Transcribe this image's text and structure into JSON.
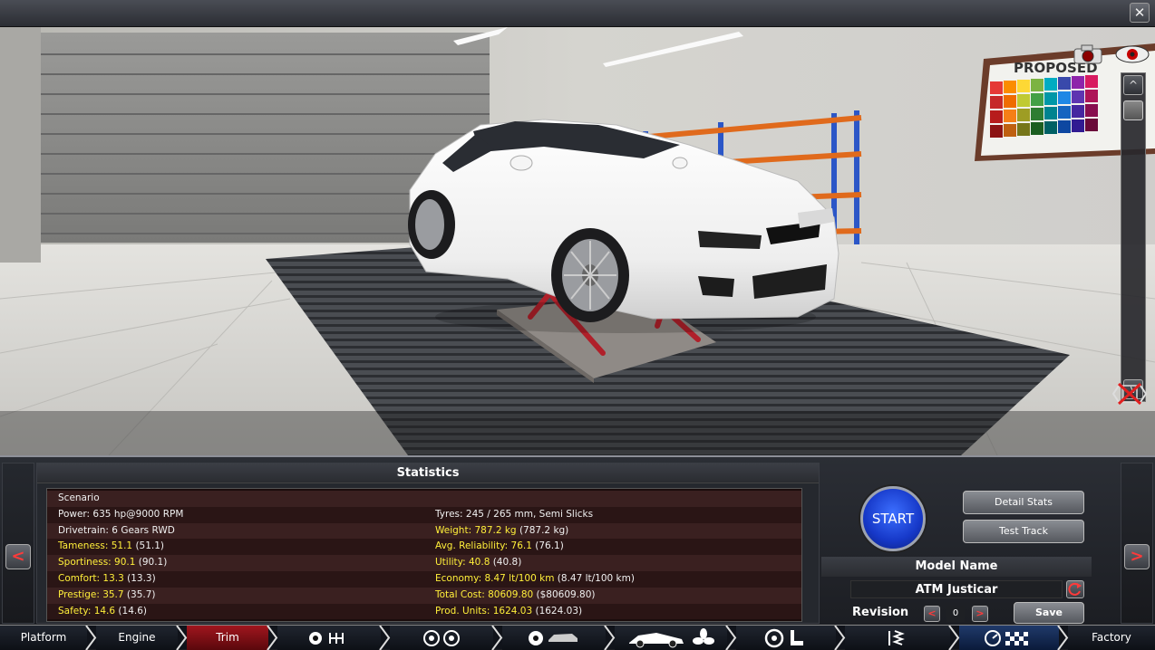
{
  "window": {
    "close_label": "✕"
  },
  "viewport": {
    "icons": [
      "camera-icon",
      "eye-icon",
      "no-hide-icon"
    ],
    "scroll_up": "^",
    "scroll_down": "v",
    "poster_text": "PROPOSED"
  },
  "statistics": {
    "title": "Statistics",
    "left": [
      {
        "label": "Scenario",
        "paren": "",
        "yellow": false
      },
      {
        "label": "Power: 635 hp@9000 RPM",
        "paren": "",
        "yellow": false
      },
      {
        "label": "Drivetrain: 6 Gears RWD",
        "paren": "",
        "yellow": false
      },
      {
        "label": "Tameness: 51.1",
        "paren": " (51.1)",
        "yellow": true
      },
      {
        "label": "Sportiness: 90.1",
        "paren": " (90.1)",
        "yellow": true
      },
      {
        "label": "Comfort: 13.3",
        "paren": " (13.3)",
        "yellow": true
      },
      {
        "label": "Prestige: 35.7",
        "paren": " (35.7)",
        "yellow": true
      },
      {
        "label": "Safety: 14.6",
        "paren": " (14.6)",
        "yellow": true
      }
    ],
    "right": [
      {
        "label": "",
        "paren": "",
        "yellow": false
      },
      {
        "label": "Tyres: 245 / 265 mm, Semi Slicks",
        "paren": "",
        "yellow": false
      },
      {
        "label": "Weight: 787.2 kg",
        "paren": " (787.2 kg)",
        "yellow": true
      },
      {
        "label": "Avg. Reliability: 76.1",
        "paren": " (76.1)",
        "yellow": true
      },
      {
        "label": "Utility: 40.8",
        "paren": " (40.8)",
        "yellow": true
      },
      {
        "label": "Economy: 8.47 lt/100 km",
        "paren": " (8.47 lt/100 km)",
        "yellow": true
      },
      {
        "label": "Total Cost: 80609.80",
        "paren": " ($80609.80)",
        "yellow": true
      },
      {
        "label": "Prod. Units: 1624.03",
        "paren": " (1624.03)",
        "yellow": true
      }
    ]
  },
  "controls": {
    "start": "START",
    "detail_stats": "Detail Stats",
    "test_track": "Test Track",
    "model_name_title": "Model Name",
    "model_name": "ATM Justicar",
    "revision_label": "Revision",
    "revision_value": "0",
    "rev_prev": "<",
    "rev_next": ">",
    "save": "Save"
  },
  "nav": {
    "prev": "<",
    "next": ">"
  },
  "tabs": {
    "platform": "Platform",
    "engine": "Engine",
    "trim": "Trim",
    "factory": "Factory",
    "icons": [
      "engine-gearbox-icon",
      "wheels-icon",
      "brakes-body-icon",
      "car-fan-icon",
      "steering-seat-icon",
      "suspension-icon",
      "test-drive-icon"
    ]
  },
  "colors": {
    "accent_red": "#ff3a3a",
    "yellow_text": "#ffef3a",
    "start_blue": "#1f47e0",
    "active_tab": "#7a0c12"
  }
}
